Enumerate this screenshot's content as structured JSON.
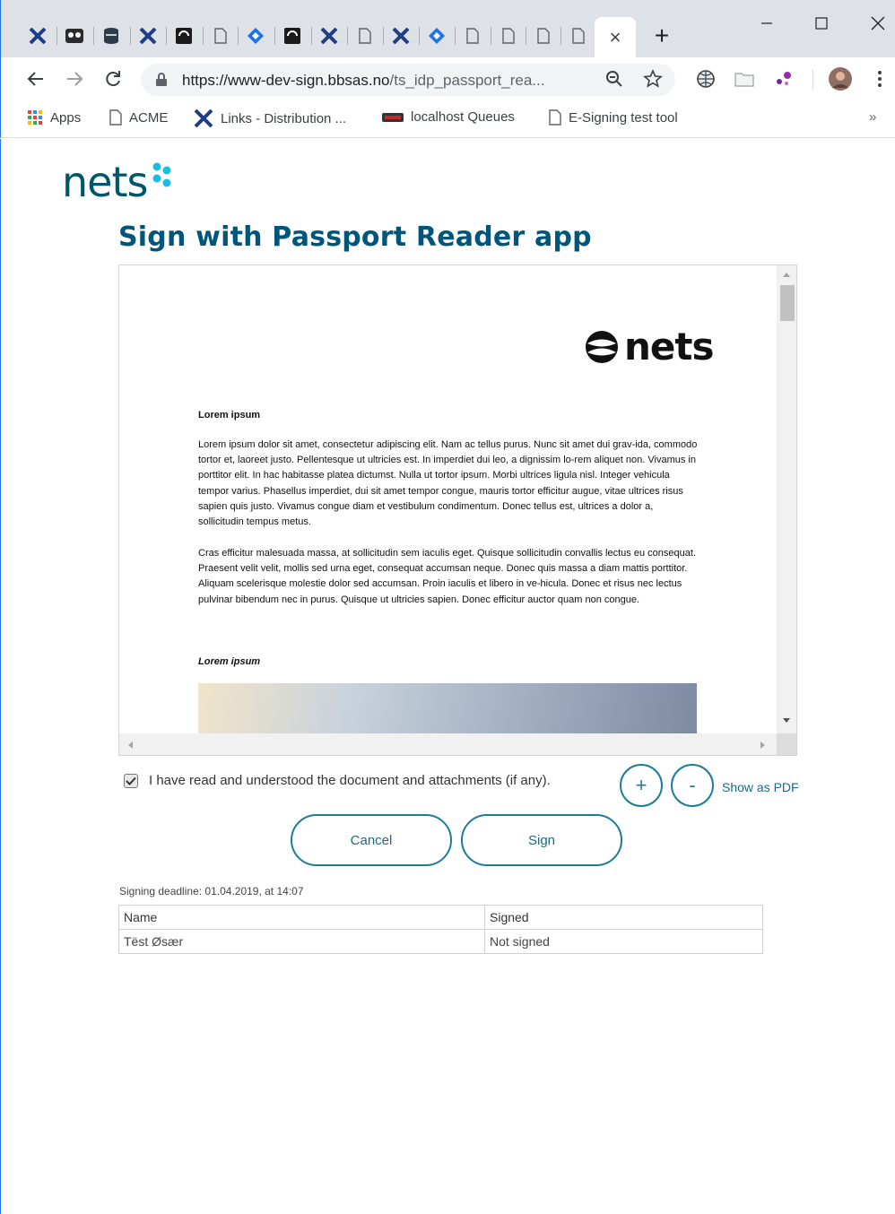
{
  "browser": {
    "tabs_count": 16,
    "active_tab_close": "×",
    "new_tab": "+",
    "window_controls": {
      "minimize": "—",
      "maximize": "☐",
      "close": "✕"
    },
    "url": {
      "host": "https://www-dev-sign.bbsas.no",
      "path": "/ts_idp_passport_rea..."
    },
    "bookmarks": [
      {
        "label": "Apps",
        "icon": "apps-grid-icon"
      },
      {
        "label": "ACME",
        "icon": "page-icon"
      },
      {
        "label": "Links - Distribution ...",
        "icon": "x-logo-icon"
      },
      {
        "label": "localhost Queues",
        "icon": "amq-icon"
      },
      {
        "label": "E-Signing test tool",
        "icon": "page-icon"
      }
    ],
    "bookmarks_more": "»"
  },
  "page": {
    "logo_text": "nets",
    "title": "Sign with Passport Reader app",
    "document": {
      "logo_text": "nets",
      "heading1": "Lorem ipsum",
      "para1": "Lorem ipsum dolor sit amet, consectetur adipiscing elit. Nam ac tellus purus. Nunc sit amet dui grav-ida, commodo tortor et, laoreet justo. Pellentesque ut ultricies est. In imperdiet dui leo, a dignissim lo-rem aliquet non. Vivamus in porttitor elit. In hac habitasse platea dictumst. Nulla ut tortor ipsum. Morbi ultrices ligula nisl. Integer vehicula tempor varius. Phasellus imperdiet, dui sit amet tempor congue, mauris tortor efficitur augue, vitae ultrices risus sapien quis justo. Vivamus congue diam et vestibulum condimentum. Donec tellus est, ultrices a dolor a, sollicitudin tempus metus.",
      "para2": "Cras efficitur malesuada massa, at sollicitudin sem iaculis eget. Quisque sollicitudin convallis lectus eu consequat. Praesent velit velit, mollis sed urna eget, consequat accumsan neque. Donec quis massa a diam mattis porttitor. Aliquam scelerisque molestie dolor sed accumsan. Proin iaculis et libero in ve-hicula. Donec et risus nec lectus pulvinar bibendum nec in purus. Quisque ut ultricies sapien. Donec efficitur auctor quam non congue.",
      "heading2": "Lorem ipsum"
    },
    "consent_label": "I have read and understood the document and attachments (if any).",
    "consent_checked": true,
    "zoom_in": "+",
    "zoom_out": "-",
    "show_pdf": "Show as PDF",
    "cancel": "Cancel",
    "sign": "Sign",
    "deadline": "Signing deadline: 01.04.2019, at 14:07",
    "table": {
      "headers": [
        "Name",
        "Signed"
      ],
      "rows": [
        [
          "Tëst Øsær",
          "Not signed"
        ]
      ]
    }
  },
  "colors": {
    "brand": "#00566a",
    "accent": "#1c7c99",
    "logo_dots": "#19bde1"
  }
}
